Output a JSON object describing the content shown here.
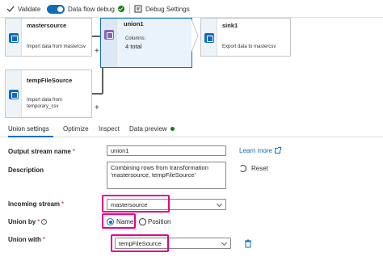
{
  "toolbar": {
    "validate_label": "Validate",
    "debug_label": "Data flow debug",
    "debug_settings_label": "Debug Settings"
  },
  "canvas": {
    "nodes": [
      {
        "title": "mastersource",
        "description": "Import data from mastercsv"
      },
      {
        "title": "union1",
        "columns_label": "Columns:",
        "columns_value": "4 total"
      },
      {
        "title": "sink1",
        "description": "Export data to mastercsv"
      },
      {
        "title": "tempFileSource",
        "description": "Import data from temporary_csv"
      }
    ],
    "plus": "+"
  },
  "tabs": [
    {
      "label": "Union settings",
      "active": true
    },
    {
      "label": "Optimize"
    },
    {
      "label": "Inspect"
    },
    {
      "label": "Data preview"
    }
  ],
  "form": {
    "output_stream": {
      "label": "Output stream name",
      "required": "*",
      "value": "union1"
    },
    "learn_more": "Learn more",
    "description": {
      "label": "Description",
      "value": "Combining rows from transformation 'mastersource, tempFileSource'"
    },
    "reset": "Reset",
    "incoming_stream": {
      "label": "Incoming stream",
      "required": "*",
      "value": "mastersource"
    },
    "union_by": {
      "label": "Union by",
      "required": "*",
      "options": [
        "Name",
        "Position"
      ],
      "selected": "Name"
    },
    "union_with": {
      "label": "Union with",
      "required": "*",
      "value": "tempFileSource"
    }
  },
  "colors": {
    "accent": "#0f6cbd",
    "highlight": "#e3008c",
    "success": "#107c10"
  }
}
